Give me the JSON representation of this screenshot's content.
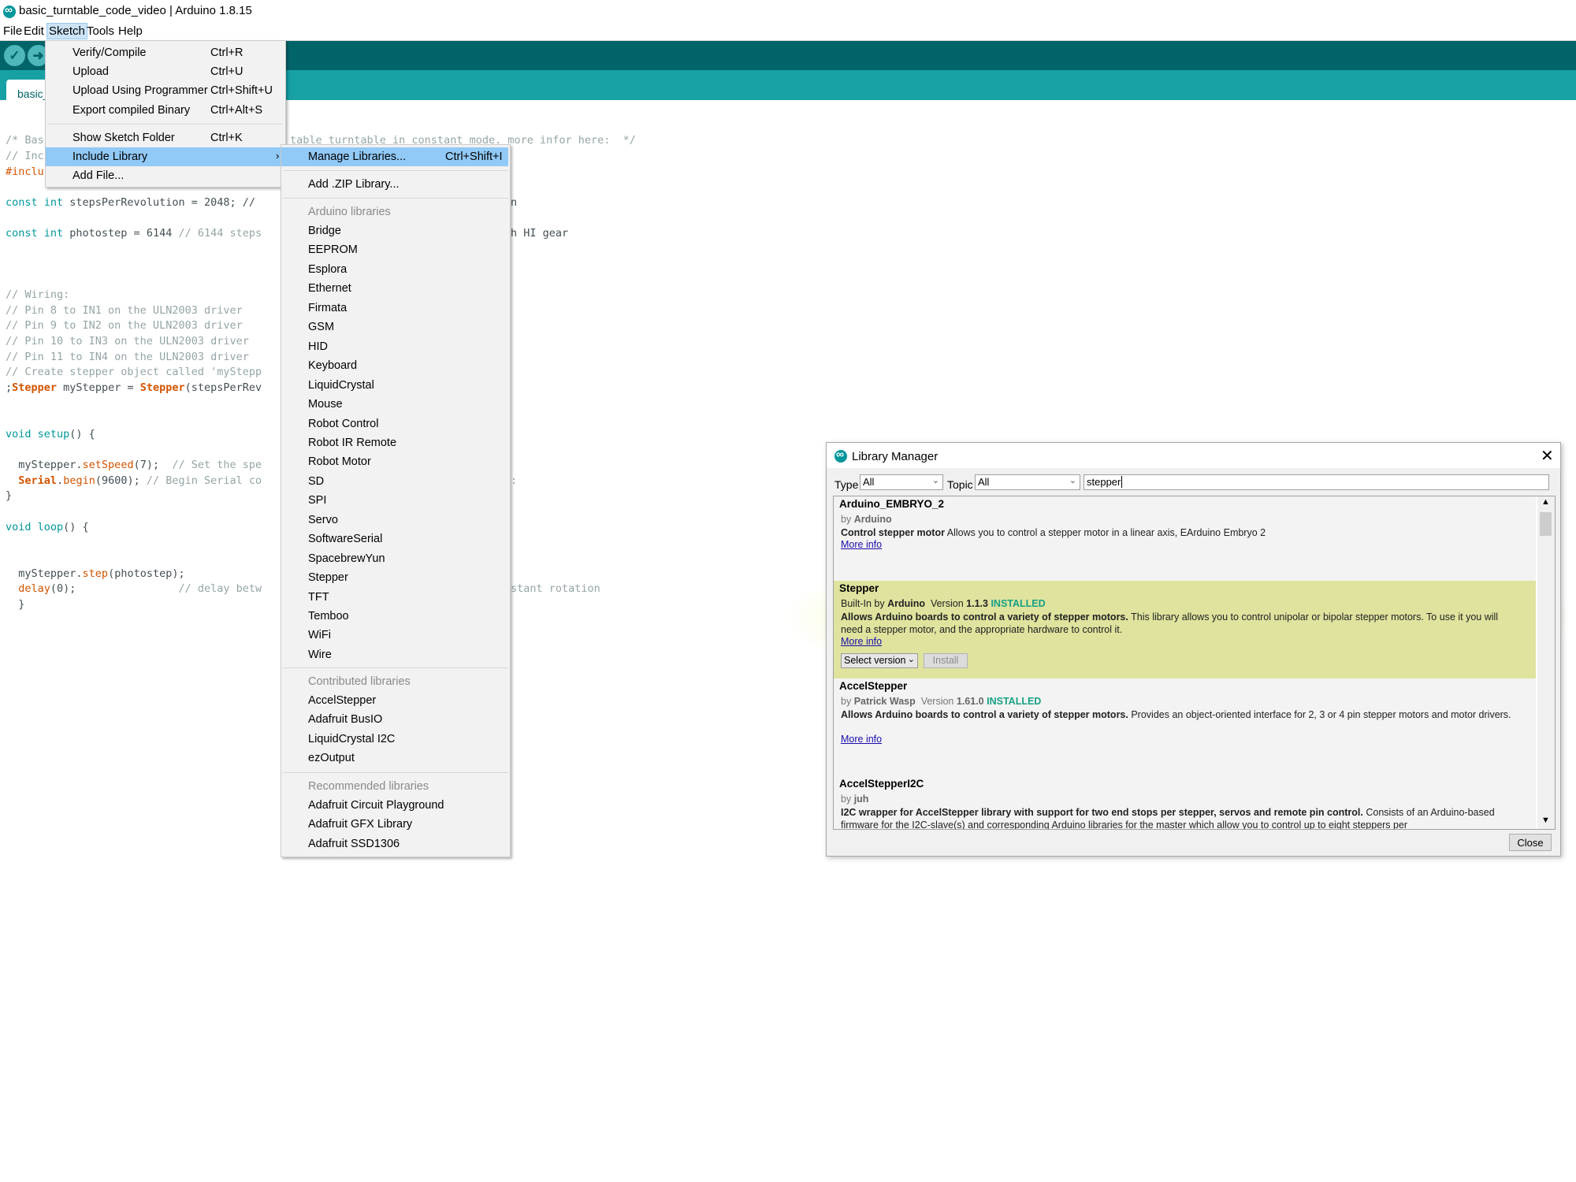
{
  "window": {
    "title": "basic_turntable_code_video | Arduino 1.8.15"
  },
  "menubar": [
    "File",
    "Edit",
    "Sketch",
    "Tools",
    "Help"
  ],
  "toolbar": {
    "verify_icon": "check-icon",
    "upload_icon": "arrow-right-icon"
  },
  "tab": {
    "label": "basic_"
  },
  "editor": {
    "lines": [
      "/* Bas",
      "// Inc",
      "#inclu",
      "const int stepsPerRevolution = 2048; // ",
      "const int photostep = 6144 // 6144 steps",
      "// Wiring:",
      "// Pin 8 to IN1 on the ULN2003 driver",
      "// Pin 9 to IN2 on the ULN2003 driver",
      "// Pin 10 to IN3 on the ULN2003 driver",
      "// Pin 11 to IN4 on the ULN2003 driver",
      "// Create stepper object called 'myStepp",
      ";Stepper myStepper = Stepper(stepsPerRev",
      "void setup() {",
      "  myStepper.setSpeed(7);  // Set the spe",
      "  Serial.begin(9600); // Begin Serial co",
      "}",
      "void loop() {",
      "  myStepper.step(photostep);",
      "  delay(0);                // delay betw",
      "  }"
    ],
    "right_fragments": [
      "table turntable in constant mode. more infor here:  */",
      "n",
      "h HI gear",
      ":",
      "stant rotation"
    ]
  },
  "sketch_menu": {
    "items": [
      {
        "label": "Verify/Compile",
        "shortcut": "Ctrl+R"
      },
      {
        "label": "Upload",
        "shortcut": "Ctrl+U"
      },
      {
        "label": "Upload Using Programmer",
        "shortcut": "Ctrl+Shift+U"
      },
      {
        "label": "Export compiled Binary",
        "shortcut": "Ctrl+Alt+S"
      },
      {
        "label": "Show Sketch Folder",
        "shortcut": "Ctrl+K"
      },
      {
        "label": "Include Library",
        "shortcut": ""
      },
      {
        "label": "Add File...",
        "shortcut": ""
      }
    ]
  },
  "library_menu": {
    "manage": {
      "label": "Manage Libraries...",
      "shortcut": "Ctrl+Shift+I"
    },
    "add_zip": "Add .ZIP Library...",
    "arduino_header": "Arduino libraries",
    "arduino": [
      "Bridge",
      "EEPROM",
      "Esplora",
      "Ethernet",
      "Firmata",
      "GSM",
      "HID",
      "Keyboard",
      "LiquidCrystal",
      "Mouse",
      "Robot Control",
      "Robot IR Remote",
      "Robot Motor",
      "SD",
      "SPI",
      "Servo",
      "SoftwareSerial",
      "SpacebrewYun",
      "Stepper",
      "TFT",
      "Temboo",
      "WiFi",
      "Wire"
    ],
    "contributed_header": "Contributed libraries",
    "contributed": [
      "AccelStepper",
      "Adafruit BusIO",
      "LiquidCrystal I2C",
      "ezOutput"
    ],
    "recommended_header": "Recommended libraries",
    "recommended": [
      "Adafruit Circuit Playground",
      "Adafruit GFX Library",
      "Adafruit SSD1306"
    ]
  },
  "library_manager": {
    "title": "Library Manager",
    "type_label": "Type",
    "type_value": "All",
    "topic_label": "Topic",
    "topic_value": "All",
    "search_value": "stepper",
    "close_label": "Close",
    "entries": [
      {
        "name": "Arduino_EMBRYO_2",
        "by_prefix": "by",
        "author": "Arduino",
        "version_label": "",
        "version": "",
        "installed": "",
        "desc_bold": "Control stepper motor",
        "desc_text": " Allows you to control a stepper motor in a linear axis, EArduino Embryo 2",
        "more": "More info"
      },
      {
        "name": "Stepper",
        "by_prefix": "Built-In by",
        "author": "Arduino",
        "version_label": "Version",
        "version": "1.1.3",
        "installed": "INSTALLED",
        "desc_bold": "Allows Arduino boards to control a variety of stepper motors.",
        "desc_text": " This library allows you to control unipolar or bipolar stepper motors. To use it you will need a stepper motor, and the appropriate hardware to control it.",
        "more": "More info",
        "select_version": "Select version",
        "install": "Install"
      },
      {
        "name": "AccelStepper",
        "by_prefix": "by",
        "author": "Patrick Wasp",
        "version_label": "Version",
        "version": "1.61.0",
        "installed": "INSTALLED",
        "desc_bold": "Allows Arduino boards to control a variety of stepper motors.",
        "desc_text": " Provides an object-oriented interface for 2, 3 or 4 pin stepper motors and motor drivers.",
        "more": "More info"
      },
      {
        "name": "AccelStepperI2C",
        "by_prefix": "by",
        "author": "juh",
        "version_label": "",
        "version": "",
        "installed": "",
        "desc_bold": "I2C wrapper for AccelStepper library with support for two end stops per stepper, servos and remote pin control.",
        "desc_text": " Consists of an Arduino-based firmware for the I2C-slave(s) and corresponding Arduino libraries for the master which allow you to control up to eight steppers per",
        "more": ""
      }
    ]
  },
  "colors": {
    "toolbar": "#006468",
    "tabbar": "#17a1a5",
    "highlight": "#91c9f7",
    "installed": "#16a085"
  }
}
